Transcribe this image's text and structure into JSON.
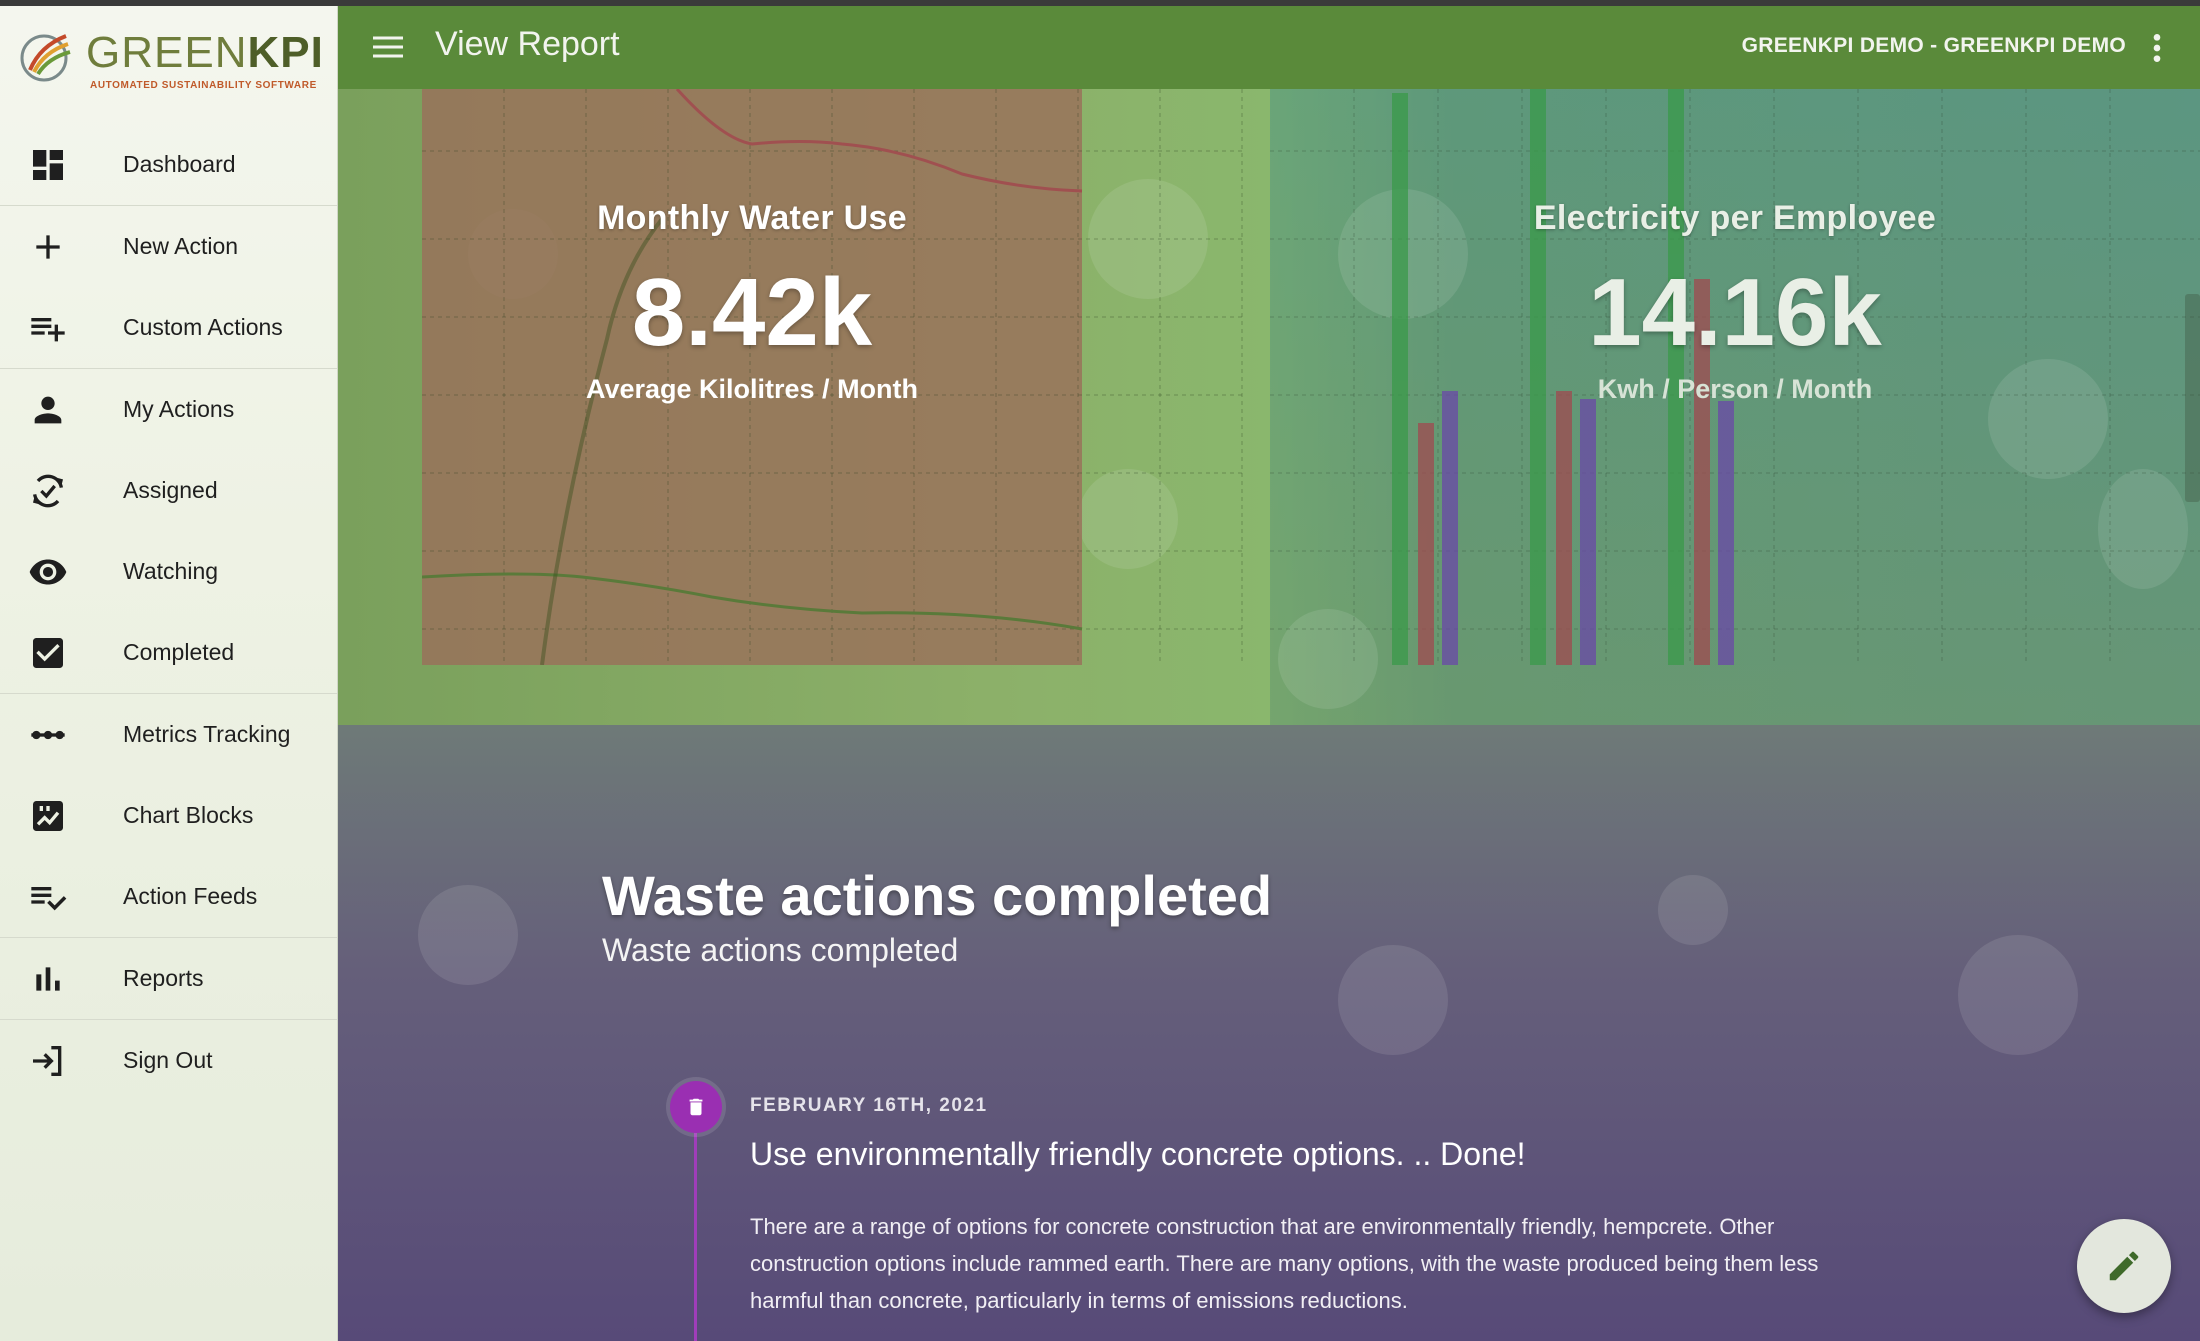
{
  "brand": {
    "name_light": "GREEN",
    "name_bold": "KPI",
    "tagline": "AUTOMATED SUSTAINABILITY SOFTWARE"
  },
  "sidebar": {
    "items": [
      {
        "label": "Dashboard",
        "icon": "dashboard-icon"
      },
      {
        "label": "New Action",
        "icon": "plus-icon"
      },
      {
        "label": "Custom Actions",
        "icon": "playlist-add-icon"
      },
      {
        "label": "My Actions",
        "icon": "person-icon"
      },
      {
        "label": "Assigned",
        "icon": "assigned-icon"
      },
      {
        "label": "Watching",
        "icon": "eye-icon"
      },
      {
        "label": "Completed",
        "icon": "checkbox-icon"
      },
      {
        "label": "Metrics Tracking",
        "icon": "dots-line-icon"
      },
      {
        "label": "Chart Blocks",
        "icon": "chart-block-icon"
      },
      {
        "label": "Action Feeds",
        "icon": "playlist-check-icon"
      },
      {
        "label": "Reports",
        "icon": "bar-chart-icon"
      },
      {
        "label": "Sign Out",
        "icon": "sign-out-icon"
      }
    ]
  },
  "header": {
    "title": "View Report",
    "account": "GREENKPI DEMO - GREENKPI DEMO"
  },
  "stats": {
    "water": {
      "title": "Monthly Water Use",
      "value": "8.42k",
      "unit": "Average Kilolitres / Month"
    },
    "electricity": {
      "title": "Electricity per Employee",
      "value": "14.16k",
      "unit": "Kwh / Person / Month"
    }
  },
  "section": {
    "heading": "Waste actions completed",
    "subheading": "Waste actions completed"
  },
  "timeline": [
    {
      "date": "FEBRUARY 16TH, 2021",
      "title": "Use environmentally friendly concrete options. .. Done!",
      "body": "There are a range of options for concrete construction that are environmentally friendly, hempcrete. Other construction options include rammed earth. There are many options, with the waste produced being them less harmful than concrete, particularly in terms of emissions reductions.",
      "icon": "trash-icon"
    }
  ],
  "fab": {
    "icon": "pencil-icon"
  },
  "colors": {
    "appbar": "#5a8a3a",
    "timeline_accent": "#9a2fb2",
    "water_card": "#9a705a",
    "bar_green": "#3a9a4a",
    "bar_red": "#a04a50",
    "bar_purple": "#6a48a8"
  }
}
